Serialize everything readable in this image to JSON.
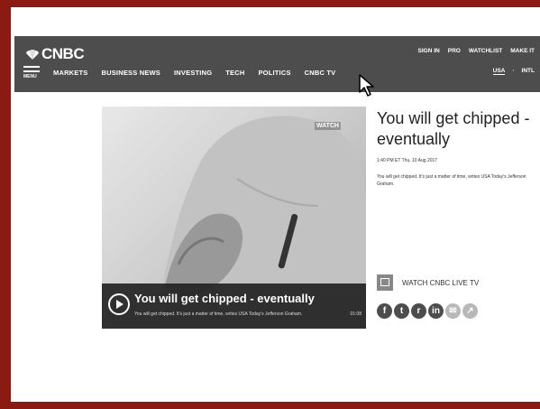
{
  "header": {
    "logo_text": "CNBC",
    "menu_label": "MENU",
    "nav": [
      "MARKETS",
      "BUSINESS NEWS",
      "INVESTING",
      "TECH",
      "POLITICS",
      "CNBC TV"
    ],
    "top_links": [
      "SIGN IN",
      "PRO",
      "WATCHLIST",
      "MAKE IT"
    ],
    "region": {
      "selected": "USA",
      "other": "INTL"
    }
  },
  "video": {
    "badge": "WATCH",
    "title": "You will get chipped - eventually",
    "subtitle": "You will get chipped. It's just a matter of time, writes USA Today's Jefferson Graham.",
    "duration": "01:08"
  },
  "article": {
    "headline": "You will get chipped - eventually",
    "dateline": "1:40 PM ET Thu, 10 Aug 2017",
    "summary": "You will get chipped. It's just a matter of time, writes USA Today's Jefferson Graham."
  },
  "watch_live": {
    "label": "WATCH CNBC LIVE TV",
    "icon": "tv-icon"
  },
  "social_icons": [
    "facebook-icon",
    "twitter-icon",
    "reddit-icon",
    "linkedin-icon",
    "email-icon",
    "share-icon"
  ],
  "colors": {
    "frame": "#8a1a12",
    "header_bg": "#4d4d4d",
    "text": "#222222"
  }
}
